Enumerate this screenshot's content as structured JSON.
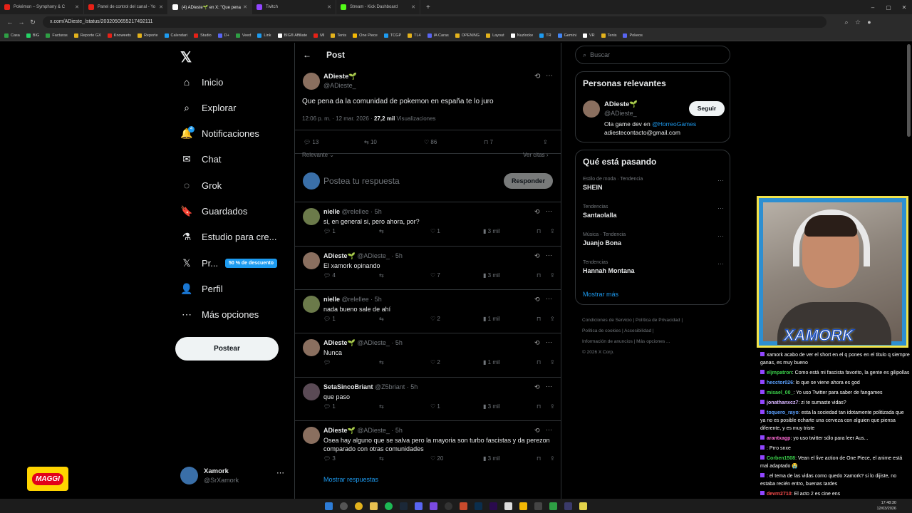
{
  "browser": {
    "tabs": [
      {
        "label": "Pokémon – Symphony & C",
        "color": "#e62117",
        "active": false
      },
      {
        "label": "Panel de control del canal - Yo",
        "color": "#e62117",
        "active": false
      },
      {
        "label": "(4) ADieste🌱 en X: \"Que pena",
        "color": "#ffffff",
        "active": true
      },
      {
        "label": "Twitch",
        "color": "#9146ff",
        "active": false
      },
      {
        "label": "Stream - Kick Dashboard",
        "color": "#53fc18",
        "active": false
      }
    ],
    "url": "x.com/ADieste_/status/2032050655217492111",
    "bookmarks": [
      "Casa",
      "BIG",
      "Facturas",
      "Reporte GX",
      "Knoweets",
      "Reporte",
      "Calendari",
      "Studio",
      "D+",
      "Veed",
      "Link",
      "BIG® Affiliate",
      "MI",
      "Tenis",
      "One Piece",
      "TCGP",
      "TL4",
      "IA Caras",
      "OPENING",
      "Layout",
      "Nuzlocke",
      "TR",
      "Gemini",
      "VR",
      "Tenis",
      "Pokeos"
    ]
  },
  "nav": {
    "items": [
      {
        "label": "Inicio",
        "icon": "home-icon",
        "glyph": "⌂"
      },
      {
        "label": "Explorar",
        "icon": "search-icon",
        "glyph": "⌕"
      },
      {
        "label": "Notificaciones",
        "icon": "bell-icon",
        "glyph": "🔔"
      },
      {
        "label": "Chat",
        "icon": "mail-icon",
        "glyph": "✉"
      },
      {
        "label": "Grok",
        "icon": "grok-icon",
        "glyph": "◌"
      },
      {
        "label": "Guardados",
        "icon": "bookmark-icon",
        "glyph": "🔖"
      },
      {
        "label": "Estudio para cre...",
        "icon": "flask-icon",
        "glyph": "⚗"
      },
      {
        "label": "Pr...",
        "icon": "x-logo-icon",
        "glyph": "𝕏"
      },
      {
        "label": "Perfil",
        "icon": "person-icon",
        "glyph": "👤"
      },
      {
        "label": "Más opciones",
        "icon": "more-circle-icon",
        "glyph": "⋯"
      }
    ],
    "notif_badge": "4",
    "premium_badge": "50 % de descuento",
    "post_button": "Postear",
    "account": {
      "name": "Xamork",
      "handle": "@SrXamork"
    },
    "sponsor": "MAGGI"
  },
  "post": {
    "header": "Post",
    "author": "ADieste🌱",
    "handle": "@ADieste_",
    "text": "Que pena da la comunidad de pokemon en españa te lo juro",
    "time": "12:06 p. m. · 12 mar. 2026 ·",
    "views": "27,2 mil",
    "views_label": "Visualizaciones",
    "replies": "13",
    "reposts": "10",
    "likes": "86",
    "bookmarks": "7",
    "sort": "Relevante",
    "quotes": "Ver citas",
    "compose_placeholder": "Postea tu respuesta",
    "reply_button": "Responder"
  },
  "replies": [
    {
      "name": "nielle",
      "handle": "@relellee · 5h",
      "text": "si, en general si, pero ahora, por?",
      "r": "1",
      "rt": "",
      "l": "1",
      "v": "3 mil"
    },
    {
      "name": "ADieste🌱",
      "handle": "@ADieste_ · 5h",
      "text": "El xamork opinando",
      "r": "4",
      "rt": "",
      "l": "7",
      "v": "3 mil"
    },
    {
      "name": "nielle",
      "handle": "@relellee · 5h",
      "text": "nada bueno sale de ahí",
      "r": "1",
      "rt": "",
      "l": "2",
      "v": "1 mil"
    },
    {
      "name": "ADieste🌱",
      "handle": "@ADieste_ · 5h",
      "text": "Nunca",
      "r": "",
      "rt": "",
      "l": "2",
      "v": "1 mil"
    },
    {
      "name": "SetaSincoBriant",
      "handle": "@Z5briant · 5h",
      "text": "que paso",
      "r": "1",
      "rt": "",
      "l": "1",
      "v": "3 mil"
    },
    {
      "name": "ADieste🌱",
      "handle": "@ADieste_ · 5h",
      "text": "Osea hay alguno que se salva pero la mayoria son turbo fascistas y da perezon comparado con otras comunidades",
      "r": "3",
      "rt": "",
      "l": "20",
      "v": "3 mil"
    }
  ],
  "show_replies": "Mostrar respuestas",
  "right": {
    "search_placeholder": "Buscar",
    "relevant_title": "Personas relevantes",
    "rel_name": "ADieste🌱",
    "rel_handle": "@ADieste_",
    "rel_bio_1": "Ola game dev en",
    "rel_bio_link": "@HorreoGames",
    "rel_bio_2": "adiestecontacto@gmail.com",
    "follow": "Seguir",
    "trends_title": "Qué está pasando",
    "trends": [
      {
        "sub": "Estilo de moda · Tendencia",
        "title": "SHEIN"
      },
      {
        "sub": "Tendencias",
        "title": "Santaolalla"
      },
      {
        "sub": "Música · Tendencia",
        "title": "Juanjo Bona"
      },
      {
        "sub": "Tendencias",
        "title": "Hannah Montana"
      }
    ],
    "show_more": "Mostrar más",
    "footer_1": "Condiciones de Servicio  |  Política de Privacidad  |",
    "footer_2": "Política de cookies  |  Accesibilidad  |",
    "footer_3": "Información de anuncios  |  Más opciones ...",
    "footer_4": "© 2026 X Corp."
  },
  "overlay": {
    "logo": "XAMORK"
  },
  "chat": [
    {
      "user": "",
      "color": "#ffffff",
      "msg": "xamork acabo de ver el short en el q pones en el titulo q siempre ganas, es muy bueno"
    },
    {
      "user": "eljmpatron",
      "color": "#3bd14b",
      "msg": ": Como está mi fascista favorito, la gente es gilipollas"
    },
    {
      "user": "hecctor026",
      "color": "#5aa0ff",
      "msg": ": lo que se viene ahora es god"
    },
    {
      "user": "misael_00_",
      "color": "#3bd14b",
      "msg": ": Yo uso Twitter para saber de fangames"
    },
    {
      "user": "jonathanxcz7",
      "color": "#d6b4ff",
      "msg": ": zi te sumaste vidas?"
    },
    {
      "user": "toquero_rayo",
      "color": "#5aa0ff",
      "msg": ": esta la sociedad tan idotamente politizada que ya no es posible echarte una cerveza con alguien que piensa diferente, y es muy triste"
    },
    {
      "user": "arantxagp",
      "color": "#ff6ad5",
      "msg": ": yo uso twitter sólo para leer Aus..."
    },
    {
      "user": "",
      "color": "#5aa0ff",
      "msg": ": Prro snxe"
    },
    {
      "user": "Corben1508",
      "color": "#3bd14b",
      "msg": ": Vean el live action de One Piece, el anime está mal adaptado 😭"
    },
    {
      "user": "",
      "color": "#5aa0ff",
      "msg": ": el tema de las vidas como quedo Xamork? si lo dijiste, no estaba recién entro, buenas tardes"
    },
    {
      "user": "devrn2710",
      "color": "#ff4d4d",
      "msg": ": El acto 2 es cine ens"
    }
  ],
  "clock": {
    "time": "17:48:30",
    "date": "12/03/2026"
  }
}
